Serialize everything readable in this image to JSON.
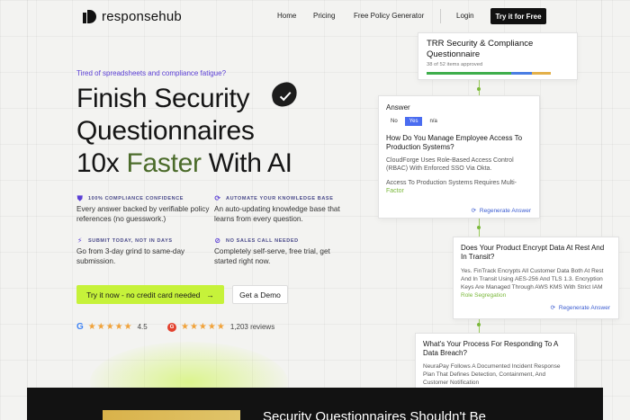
{
  "nav": {
    "brand": "responsehub",
    "links": [
      "Home",
      "Pricing",
      "Free Policy Generator"
    ],
    "login": "Login",
    "cta": "Try it for Free"
  },
  "hero": {
    "tagline": "Tired of spreadsheets and compliance fatigue?",
    "headline_line1": "Finish Security",
    "headline_line2": "Questionnaires",
    "headline_line3_a": "10x ",
    "headline_line3_accent": "Faster",
    "headline_line3_b": " With AI",
    "features": [
      {
        "icon": "shield-check-icon",
        "glyph": "⛊",
        "title": "100% COMPLIANCE CONFIDENCE",
        "body": "Every answer backed by verifiable policy references (no guesswork.)"
      },
      {
        "icon": "refresh-icon",
        "glyph": "⟳",
        "title": "AUTOMATE YOUR KNOWLEDGE BASE",
        "body": "An auto-updating knowledge base that learns from every question."
      },
      {
        "icon": "lightning-icon",
        "glyph": "⚡",
        "title": "SUBMIT TODAY, NOT IN DAYS",
        "body": "Go from 3-day grind to same-day submission."
      },
      {
        "icon": "no-sales-icon",
        "glyph": "⊘",
        "title": "NO SALES CALL NEEDED",
        "body": "Completely self-serve, free trial, get started right now."
      }
    ],
    "primary_cta": "Try it now - no credit card needed",
    "secondary_cta": "Get a Demo",
    "ratings": [
      {
        "source": "google",
        "logo": "G",
        "stars": "★★★★★",
        "value": "4.5"
      },
      {
        "source": "g2",
        "logo": "G",
        "stars": "★★★★★",
        "value": "1,203 reviews"
      }
    ]
  },
  "questionnaire": {
    "title": "TRR Security & Compliance Questionnaire",
    "status": "38 of 52 items approved",
    "progress": {
      "approved": 0.58,
      "in_review": 0.14,
      "pending": 0.13
    },
    "colors": {
      "approved": "#3fae4c",
      "in_review": "#4a7de3",
      "pending": "#e3b04a"
    }
  },
  "answer_card": {
    "label": "Answer",
    "options": [
      "No",
      "Yes",
      "n/a"
    ],
    "selected": "Yes",
    "question": "How Do You Manage Employee Access To Production Systems?",
    "answer_1": "CloudForge Uses Role-Based Access Control (RBAC) With Enforced SSO Via Okta.",
    "answer_2": "Access To Production Systems Requires Multi-",
    "answer_2_fade": "Factor",
    "regenerate": "Regenerate Answer"
  },
  "card_encrypt": {
    "question": "Does Your Product Encrypt Data At Rest And In Transit?",
    "answer": "Yes. FinTrack Encrypts All Customer Data Both At Rest And In Transit Using AES-256 And TLS 1.3. Encryption Keys Are Managed Through AWS KMS With Strict IAM ",
    "answer_fade": "Role Segregation",
    "regenerate": "Regenerate Answer"
  },
  "card_breach": {
    "question": "What's Your Process For Responding To A Data Breach?",
    "answer": "NeuraPay Follows A Documented Incident Response Plan That Defines Detection, Containment, And Customer Notification"
  },
  "bottom": {
    "title": "Security Questionnaires Shouldn't Be"
  }
}
